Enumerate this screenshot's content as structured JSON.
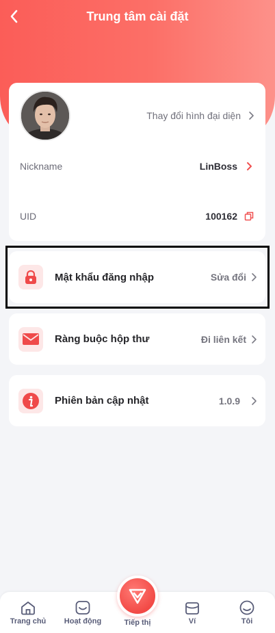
{
  "header": {
    "title": "Trung tâm cài đặt"
  },
  "profile": {
    "change_avatar_label": "Thay đổi hình đại diện",
    "nickname_label": "Nickname",
    "nickname_value": "LinBoss",
    "uid_label": "UID",
    "uid_value": "100162"
  },
  "menu": [
    {
      "label": "Mật khẩu đăng nhập",
      "value": "Sửa đổi",
      "icon": "lock-icon"
    },
    {
      "label": "Ràng buộc hộp thư",
      "value": "Đi liên kết",
      "icon": "mail-icon"
    },
    {
      "label": "Phiên bản cập nhật",
      "value": "1.0.9",
      "icon": "info-icon"
    }
  ],
  "tabbar": {
    "items": [
      {
        "label": "Trang chủ",
        "icon": "home-icon"
      },
      {
        "label": "Hoạt động",
        "icon": "activity-icon"
      },
      {
        "label": "Tiếp thị",
        "icon": "diamond-icon"
      },
      {
        "label": "Ví",
        "icon": "wallet-icon"
      },
      {
        "label": "Tôi",
        "icon": "profile-icon"
      }
    ]
  },
  "colors": {
    "accent": "#fb5d58",
    "background": "#f4f5f8",
    "icon_bg": "#fde7e7",
    "tab_label": "#585c78"
  }
}
